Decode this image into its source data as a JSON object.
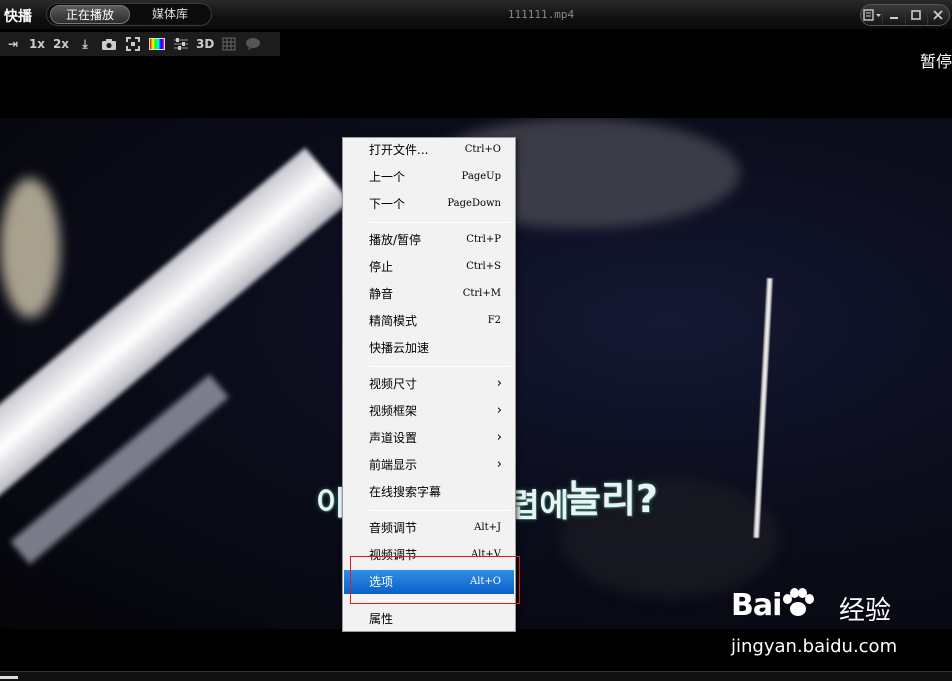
{
  "app": {
    "logo": "快播",
    "tabs": [
      {
        "label": "正在播放",
        "active": true
      },
      {
        "label": "媒体库",
        "active": false
      }
    ],
    "file_title": "111111.mp4",
    "window_buttons": [
      "menu-layout-icon",
      "minimize-icon",
      "maximize-icon",
      "close-icon"
    ]
  },
  "toolbar": {
    "items": [
      {
        "name": "sync-icon",
        "text": "⇥"
      },
      {
        "name": "speed-1x",
        "text": "1x"
      },
      {
        "name": "speed-2x",
        "text": "2x"
      },
      {
        "name": "download-icon",
        "text": "⤓"
      },
      {
        "name": "camera-icon",
        "text": ""
      },
      {
        "name": "fullscreen-icon",
        "text": ""
      },
      {
        "name": "color-icon",
        "text": ""
      },
      {
        "name": "settings-sliders-icon",
        "text": ""
      },
      {
        "name": "3d-toggle",
        "text": "3D"
      },
      {
        "name": "mosaic-icon",
        "text": "▦"
      },
      {
        "name": "comment-icon",
        "text": "💬"
      }
    ]
  },
  "overlay": {
    "pause_text": "暂停"
  },
  "video": {
    "subtitle_left": "이",
    "subtitle_mid": "렵에",
    "subtitle_right": "놀리?"
  },
  "context_menu": {
    "items": [
      {
        "label": "打开文件...",
        "shortcut": "Ctrl+O"
      },
      {
        "label": "上一个",
        "shortcut": "PageUp"
      },
      {
        "label": "下一个",
        "shortcut": "PageDown"
      },
      {
        "label": "播放/暂停",
        "shortcut": "Ctrl+P"
      },
      {
        "label": "停止",
        "shortcut": "Ctrl+S"
      },
      {
        "label": "静音",
        "shortcut": "Ctrl+M"
      },
      {
        "label": "精简模式",
        "shortcut": "F2"
      },
      {
        "label": "快播云加速",
        "shortcut": ""
      },
      {
        "label": "视频尺寸",
        "submenu": true
      },
      {
        "label": "视频框架",
        "submenu": true
      },
      {
        "label": "声道设置",
        "submenu": true
      },
      {
        "label": "前端显示",
        "submenu": true
      },
      {
        "label": "在线搜索字幕",
        "shortcut": ""
      },
      {
        "label": "音频调节",
        "shortcut": "Alt+J"
      },
      {
        "label": "视频调节",
        "shortcut": "Alt+V"
      },
      {
        "label": "选项",
        "shortcut": "Alt+O",
        "selected": true
      },
      {
        "label": "属性",
        "shortcut": ""
      }
    ],
    "submenu_arrow": "›"
  },
  "watermark": {
    "brand_left": "Bai",
    "brand_right": "经验",
    "url": "jingyan.baidu.com"
  },
  "colors": {
    "selection": "#0a5fc8",
    "highlight_box": "#d81e1e",
    "menu_bg": "#f2f2f2"
  }
}
